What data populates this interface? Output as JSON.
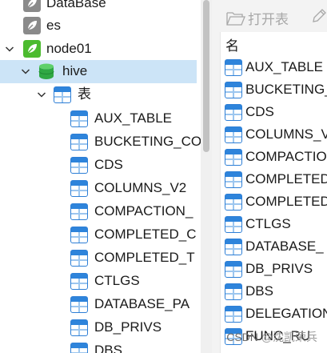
{
  "tree": {
    "items": [
      {
        "label": "DataBase",
        "kind": "connection-grey"
      },
      {
        "label": "es",
        "kind": "connection-grey"
      },
      {
        "label": "node01",
        "kind": "connection-green",
        "expanded": true
      },
      {
        "label": "hive",
        "kind": "database",
        "expanded": true,
        "selected": true
      },
      {
        "label": "表",
        "kind": "tables-folder",
        "expanded": true
      }
    ],
    "tables": [
      "AUX_TABLE",
      "BUCKETING_CO",
      "CDS",
      "COLUMNS_V2",
      "COMPACTION_",
      "COMPLETED_C",
      "COMPLETED_T",
      "CTLGS",
      "DATABASE_PA",
      "DB_PRIVS",
      "DBS"
    ]
  },
  "toolbar": {
    "open_label": "打开表",
    "open_icon": "folder-open-icon",
    "edit_icon": "pencil-icon"
  },
  "object_list": {
    "header": "名",
    "items": [
      "AUX_TABLE",
      "BUCKETING_",
      "CDS",
      "COLUMNS_V",
      "COMPACTIO",
      "COMPLETED",
      "COMPLETED",
      "CTLGS",
      "DATABASE_",
      "DB_PRIVS",
      "DBS",
      "DELEGATION",
      "FUNC_RU"
    ]
  },
  "watermark": {
    "site": "CSDN",
    "user": "@沈凯荣兵"
  },
  "colors": {
    "selection": "#cce4f7",
    "table_icon": "#2e84db",
    "db_green": "#3bb54a",
    "node_green": "#4cbb2f"
  }
}
